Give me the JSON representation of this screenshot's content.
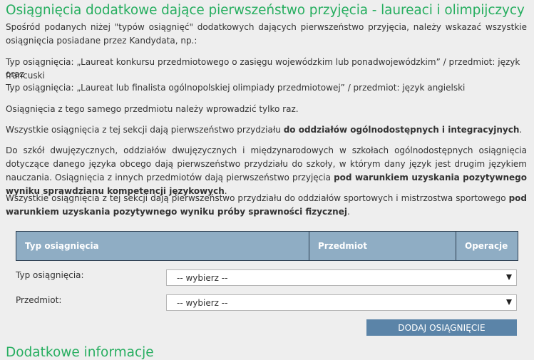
{
  "header": {
    "title": "Osiągnięcia dodatkowe dające pierwszeństwo przyjęcia - laureaci i olimpijczycy"
  },
  "intro": {
    "text": "Spośród podanych niżej \"typów osiągnięć\" dodatkowych dających pierwszeństwo przyjęcia, należy wskazać wszystkie osiągnięcia posiadane przez Kandydata, np.:"
  },
  "examples": {
    "line1": "Typ osiągnięcia: „Laureat konkursu przedmiotowego o zasięgu wojewódzkim lub ponadwojewódzkim” / przedmiot: język francuski",
    "line1_cont": "oraz",
    "line2": "Typ osiągnięcia: „Laureat lub finalista ogólnopolskiej olimpiady przedmiotowej” / przedmiot: język angielski"
  },
  "notes": {
    "same_subject": "Osiągnięcia z tego samego przedmiotu należy wprowadzić tylko raz.",
    "priority_prefix": "Wszystkie osiągnięcia z tej sekcji dają pierwszeństwo przydziału ",
    "priority_bold": "do oddziałów ogólnodostępnych i integracyjnych",
    "priority_suffix": ".",
    "bilingual_text": "Do szkół dwujęzycznych, oddziałów dwujęzycznych i międzynarodowych w szkołach ogólnodostępnych osiągnięcia dotyczące danego języka obcego dają pierwszeństwo przydziału do szkoły, w którym dany język jest drugim językiem nauczania. Osiągnięcia z innych przedmiotów dają pierwszeństwo przyjęcia ",
    "bilingual_bold": "pod warunkiem uzyskania pozytywnego wyniku sprawdzianu kompetencji językowych",
    "bilingual_suffix": ".",
    "sport_text": "Wszystkie osiągnięcia z tej sekcji dają pierwszeństwo przydziału do oddziałów sportowych i mistrzostwa sportowego ",
    "sport_bold": "pod warunkiem uzyskania pozytywnego wyniku próby sprawności fizycznej",
    "sport_suffix": "."
  },
  "table": {
    "col_type": "Typ osiągnięcia",
    "col_subject": "Przedmiot",
    "col_ops": "Operacje"
  },
  "form": {
    "type_label": "Typ osiągnięcia:",
    "type_value": "-- wybierz --",
    "subject_label": "Przedmiot:",
    "subject_value": "-- wybierz --",
    "add_button": "DODAJ OSIĄGNIĘCIE"
  },
  "next_section": {
    "title": "Dodatkowe informacje"
  },
  "colors": {
    "title_green": "#27ae60",
    "table_header_bg": "#8fadc4",
    "button_bg": "#5b84a8"
  }
}
